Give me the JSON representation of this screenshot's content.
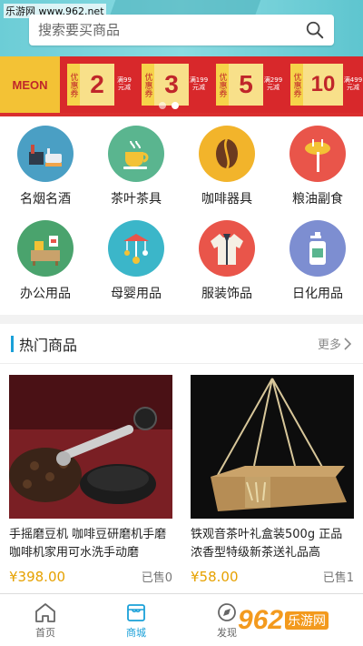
{
  "watermark": "乐游网 www.962.net",
  "search": {
    "placeholder": "搜索要买商品"
  },
  "banner": {
    "logo_text": "MEON",
    "coupons": [
      {
        "tag": "优惠券",
        "value": "2",
        "sub": "满99元减"
      },
      {
        "tag": "优惠券",
        "value": "3",
        "sub": "满199元减"
      },
      {
        "tag": "优惠券",
        "value": "5",
        "sub": "满299元减"
      },
      {
        "tag": "优惠券",
        "value": "10",
        "sub": "满499元减"
      }
    ],
    "slide_count": 2,
    "active_slide": 1
  },
  "categories": [
    {
      "label": "名烟名酒",
      "icon": "tobacco-wine-icon",
      "color": "#4a9fc4"
    },
    {
      "label": "茶叶茶具",
      "icon": "tea-cup-icon",
      "color": "#5ab58f"
    },
    {
      "label": "咖啡器具",
      "icon": "coffee-bean-icon",
      "color": "#f2b42b"
    },
    {
      "label": "粮油副食",
      "icon": "sausage-fork-icon",
      "color": "#e9554a"
    },
    {
      "label": "办公用品",
      "icon": "office-desk-icon",
      "color": "#4aa36d"
    },
    {
      "label": "母婴用品",
      "icon": "baby-mobile-icon",
      "color": "#3bb6c9"
    },
    {
      "label": "服装饰品",
      "icon": "jacket-icon",
      "color": "#e9554a"
    },
    {
      "label": "日化用品",
      "icon": "soap-bottle-icon",
      "color": "#7d8ed1"
    }
  ],
  "hot": {
    "title": "热门商品",
    "more": "更多",
    "products": [
      {
        "name": "手摇磨豆机 咖啡豆研磨机手磨咖啡机家用可水洗手动磨",
        "price": "¥398.00",
        "sold": "已售0"
      },
      {
        "name": "铁观音茶叶礼盒装500g 正品浓香型特级新茶送礼品高",
        "price": "¥58.00",
        "sold": "已售1"
      }
    ]
  },
  "tabbar": [
    {
      "label": "首页",
      "icon": "home-icon",
      "active": false
    },
    {
      "label": "商城",
      "icon": "shop-icon",
      "active": true
    },
    {
      "label": "发现",
      "icon": "discover-icon",
      "active": false
    }
  ],
  "colors": {
    "accent": "#1aa0d8",
    "price": "#e6a100",
    "banner_red": "#d8282b"
  },
  "site_mark": {
    "num": "962",
    "cn": "乐游网"
  }
}
